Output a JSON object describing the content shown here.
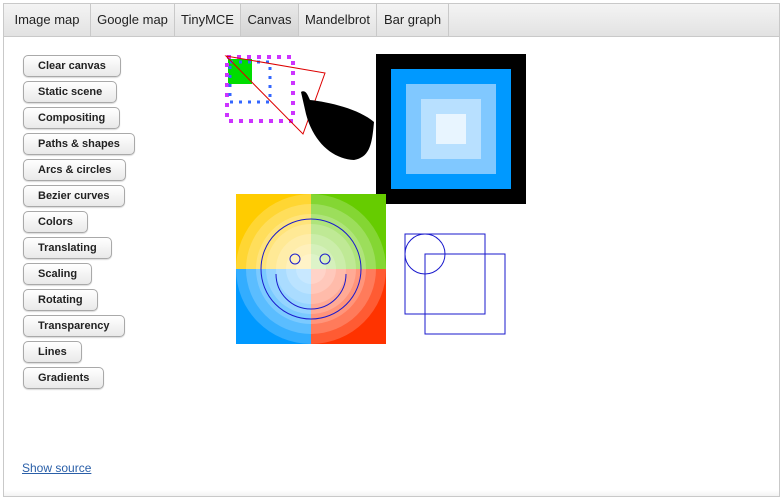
{
  "tabs": [
    {
      "label": "Image map",
      "active": false
    },
    {
      "label": "Google map",
      "active": false
    },
    {
      "label": "TinyMCE",
      "active": false
    },
    {
      "label": "Canvas",
      "active": true
    },
    {
      "label": "Mandelbrot",
      "active": false
    },
    {
      "label": "Bar graph",
      "active": false
    }
  ],
  "sidebar": {
    "buttons": [
      "Clear canvas",
      "Static scene",
      "Compositing",
      "Paths & shapes",
      "Arcs & circles",
      "Bezier curves",
      "Colors",
      "Translating",
      "Scaling",
      "Rotating",
      "Transparency",
      "Lines",
      "Gradients"
    ]
  },
  "footer": {
    "show_source_label": "Show source"
  },
  "colors": {
    "tab_active_bg": "#d9d9d9",
    "link": "#2a5fa8",
    "yellow": "#ffcc00",
    "green": "#66cc00",
    "blue": "#0099ff",
    "red": "#ff3300",
    "navy_stroke": "#1a1acc"
  }
}
